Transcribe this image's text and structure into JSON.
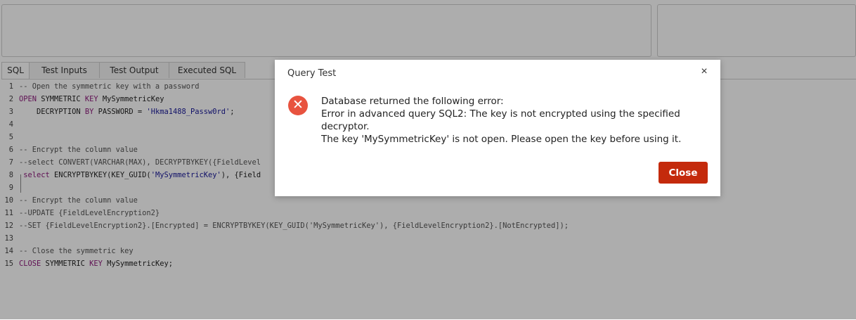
{
  "tabs": [
    {
      "label": "SQL"
    },
    {
      "label": "Test Inputs"
    },
    {
      "label": "Test Output"
    },
    {
      "label": "Executed SQL"
    }
  ],
  "code": [
    {
      "n": "1",
      "parts": [
        {
          "t": "-- Open the symmetric key with a password",
          "c": "cm"
        }
      ]
    },
    {
      "n": "2",
      "parts": [
        {
          "t": "OPEN",
          "c": "kw"
        },
        {
          "t": " SYMMETRIC ",
          "c": ""
        },
        {
          "t": "KEY",
          "c": "kw"
        },
        {
          "t": " MySymmetricKey",
          "c": ""
        }
      ]
    },
    {
      "n": "3",
      "parts": [
        {
          "t": "    DECRYPTION ",
          "c": ""
        },
        {
          "t": "BY",
          "c": "kw"
        },
        {
          "t": " PASSWORD = ",
          "c": ""
        },
        {
          "t": "'Hkma1488_Passw0rd'",
          "c": "str"
        },
        {
          "t": ";",
          "c": ""
        }
      ]
    },
    {
      "n": "4",
      "parts": []
    },
    {
      "n": "5",
      "parts": []
    },
    {
      "n": "6",
      "parts": [
        {
          "t": "-- Encrypt the column value",
          "c": "cm"
        }
      ]
    },
    {
      "n": "7",
      "parts": [
        {
          "t": "--select CONVERT(VARCHAR(MAX), DECRYPTBYKEY({FieldLevel",
          "c": "cm"
        }
      ]
    },
    {
      "n": "8",
      "parts": [
        {
          "t": " select",
          "c": "kw"
        },
        {
          "t": " ENCRYPTBYKEY(KEY_GUID(",
          "c": ""
        },
        {
          "t": "'MySymmetricKey'",
          "c": "str"
        },
        {
          "t": "), {Field",
          "c": ""
        }
      ]
    },
    {
      "n": "9",
      "parts": []
    },
    {
      "n": "10",
      "parts": [
        {
          "t": "-- Encrypt the column value",
          "c": "cm"
        }
      ]
    },
    {
      "n": "11",
      "parts": [
        {
          "t": "--UPDATE {FieldLevelEncryption2}",
          "c": "cm"
        }
      ]
    },
    {
      "n": "12",
      "parts": [
        {
          "t": "--SET {FieldLevelEncryption2}.[Encrypted] = ENCRYPTBYKEY(KEY_GUID('MySymmetricKey'), {FieldLevelEncryption2}.[NotEncrypted]);",
          "c": "cm"
        }
      ]
    },
    {
      "n": "13",
      "parts": []
    },
    {
      "n": "14",
      "parts": [
        {
          "t": "-- Close the symmetric key",
          "c": "cm"
        }
      ]
    },
    {
      "n": "15",
      "parts": [
        {
          "t": "CLOSE",
          "c": "kw"
        },
        {
          "t": " SYMMETRIC ",
          "c": ""
        },
        {
          "t": "KEY",
          "c": "kw"
        },
        {
          "t": " MySymmetricKey;",
          "c": ""
        }
      ]
    }
  ],
  "dialog": {
    "title": "Query Test",
    "close_icon": "×",
    "error_icon": "✕",
    "messages": [
      "Database returned the following error:",
      "Error in advanced query SQL2: The key is not encrypted using the specified decryptor.",
      "The key 'MySymmetricKey' is not open. Please open the key before using it."
    ],
    "close_button": "Close"
  },
  "colors": {
    "accent": "#c42a0c",
    "error": "#e8533f",
    "keyword": "#8e1b7c"
  }
}
